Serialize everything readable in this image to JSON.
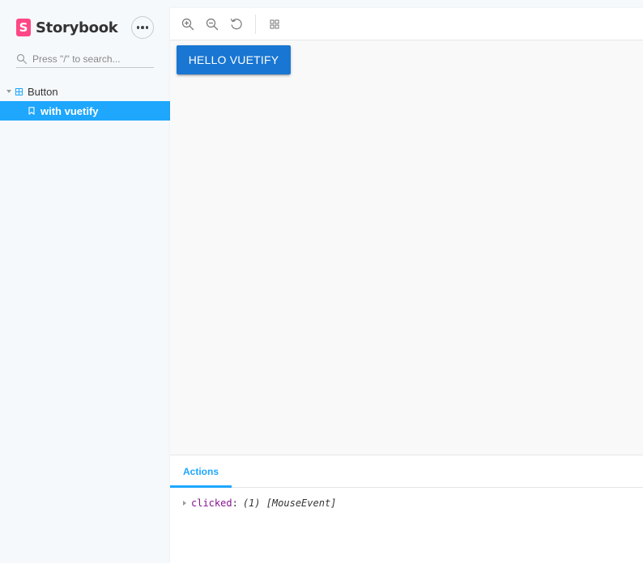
{
  "sidebar": {
    "brand": {
      "logo_letter": "S",
      "name": "Storybook"
    },
    "search": {
      "placeholder": "Press \"/\" to search...",
      "value": ""
    },
    "tree": {
      "group": {
        "label": "Button",
        "icon": "component-icon"
      },
      "story": {
        "label": "with vuetify",
        "icon": "bookmark-icon",
        "selected": true
      }
    }
  },
  "toolbar": {
    "tools": [
      "zoom-in-icon",
      "zoom-out-icon",
      "zoom-reset-icon",
      "grid-icon"
    ]
  },
  "canvas": {
    "button_label": "HELLO VUETIFY"
  },
  "panel": {
    "active_tab": "Actions",
    "log": [
      {
        "key": "clicked",
        "value": "(1) [MouseEvent]"
      }
    ]
  },
  "colors": {
    "storybook_pink": "#ff4785",
    "selection_blue": "#1ea7fd",
    "vuetify_primary": "#1976d2",
    "log_key_purple": "#881391"
  }
}
